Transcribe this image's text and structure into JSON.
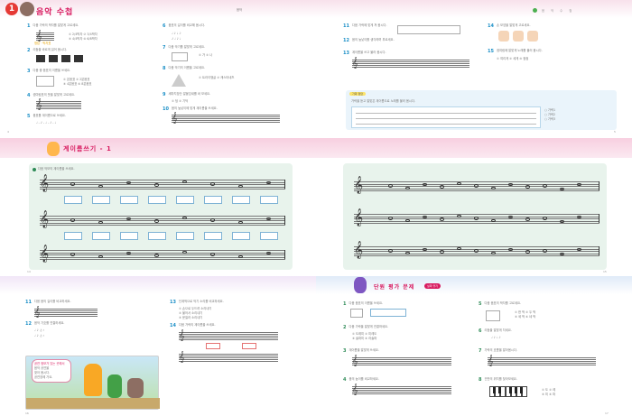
{
  "pageA": {
    "badge_number": "1",
    "title": "음악 수첩",
    "header_right": "음 악 수 첩",
    "footer_left": "4",
    "footer_right": "5",
    "answer_note_label": "음",
    "mid_number": "1",
    "instruction_label": "가락 정답",
    "top_numbers": [
      "1",
      "2",
      "3",
      "4",
      "5",
      "6",
      "7",
      "8",
      "9",
      "10",
      "11",
      "12",
      "13",
      "14",
      "15",
      "16"
    ]
  },
  "pageB": {
    "title": "계이름쓰기 - 1",
    "instruction": "다음 악보의 계이름을 쓰세요.",
    "footer_left": "14",
    "footer_right": "15"
  },
  "pageC": {
    "title": "단원 평가 문제",
    "badge_label": "실력 쌓기",
    "footer_left": "16",
    "footer_right": "17",
    "card_title": "공연 정보가 있는 곳에서",
    "card_lines": [
      "음악 공연을",
      "찾아 봅시다.",
      "공연장에 가요."
    ],
    "left_numbers": [
      "11",
      "12",
      "13",
      "14"
    ],
    "right_numbers": [
      "1",
      "2",
      "3",
      "4",
      "5",
      "6",
      "7",
      "8"
    ]
  },
  "colors": {
    "accent_red": "#e53935",
    "accent_pink": "#d81b60",
    "accent_blue": "#1b8fc7",
    "accent_green": "#2e8b57",
    "panel_green": "#e8f3ec"
  },
  "icons": [
    "treble-clef-icon",
    "quarter-note-icon",
    "piano-keys-icon",
    "cartoon-character-icon",
    "speech-bubble-icon"
  ]
}
